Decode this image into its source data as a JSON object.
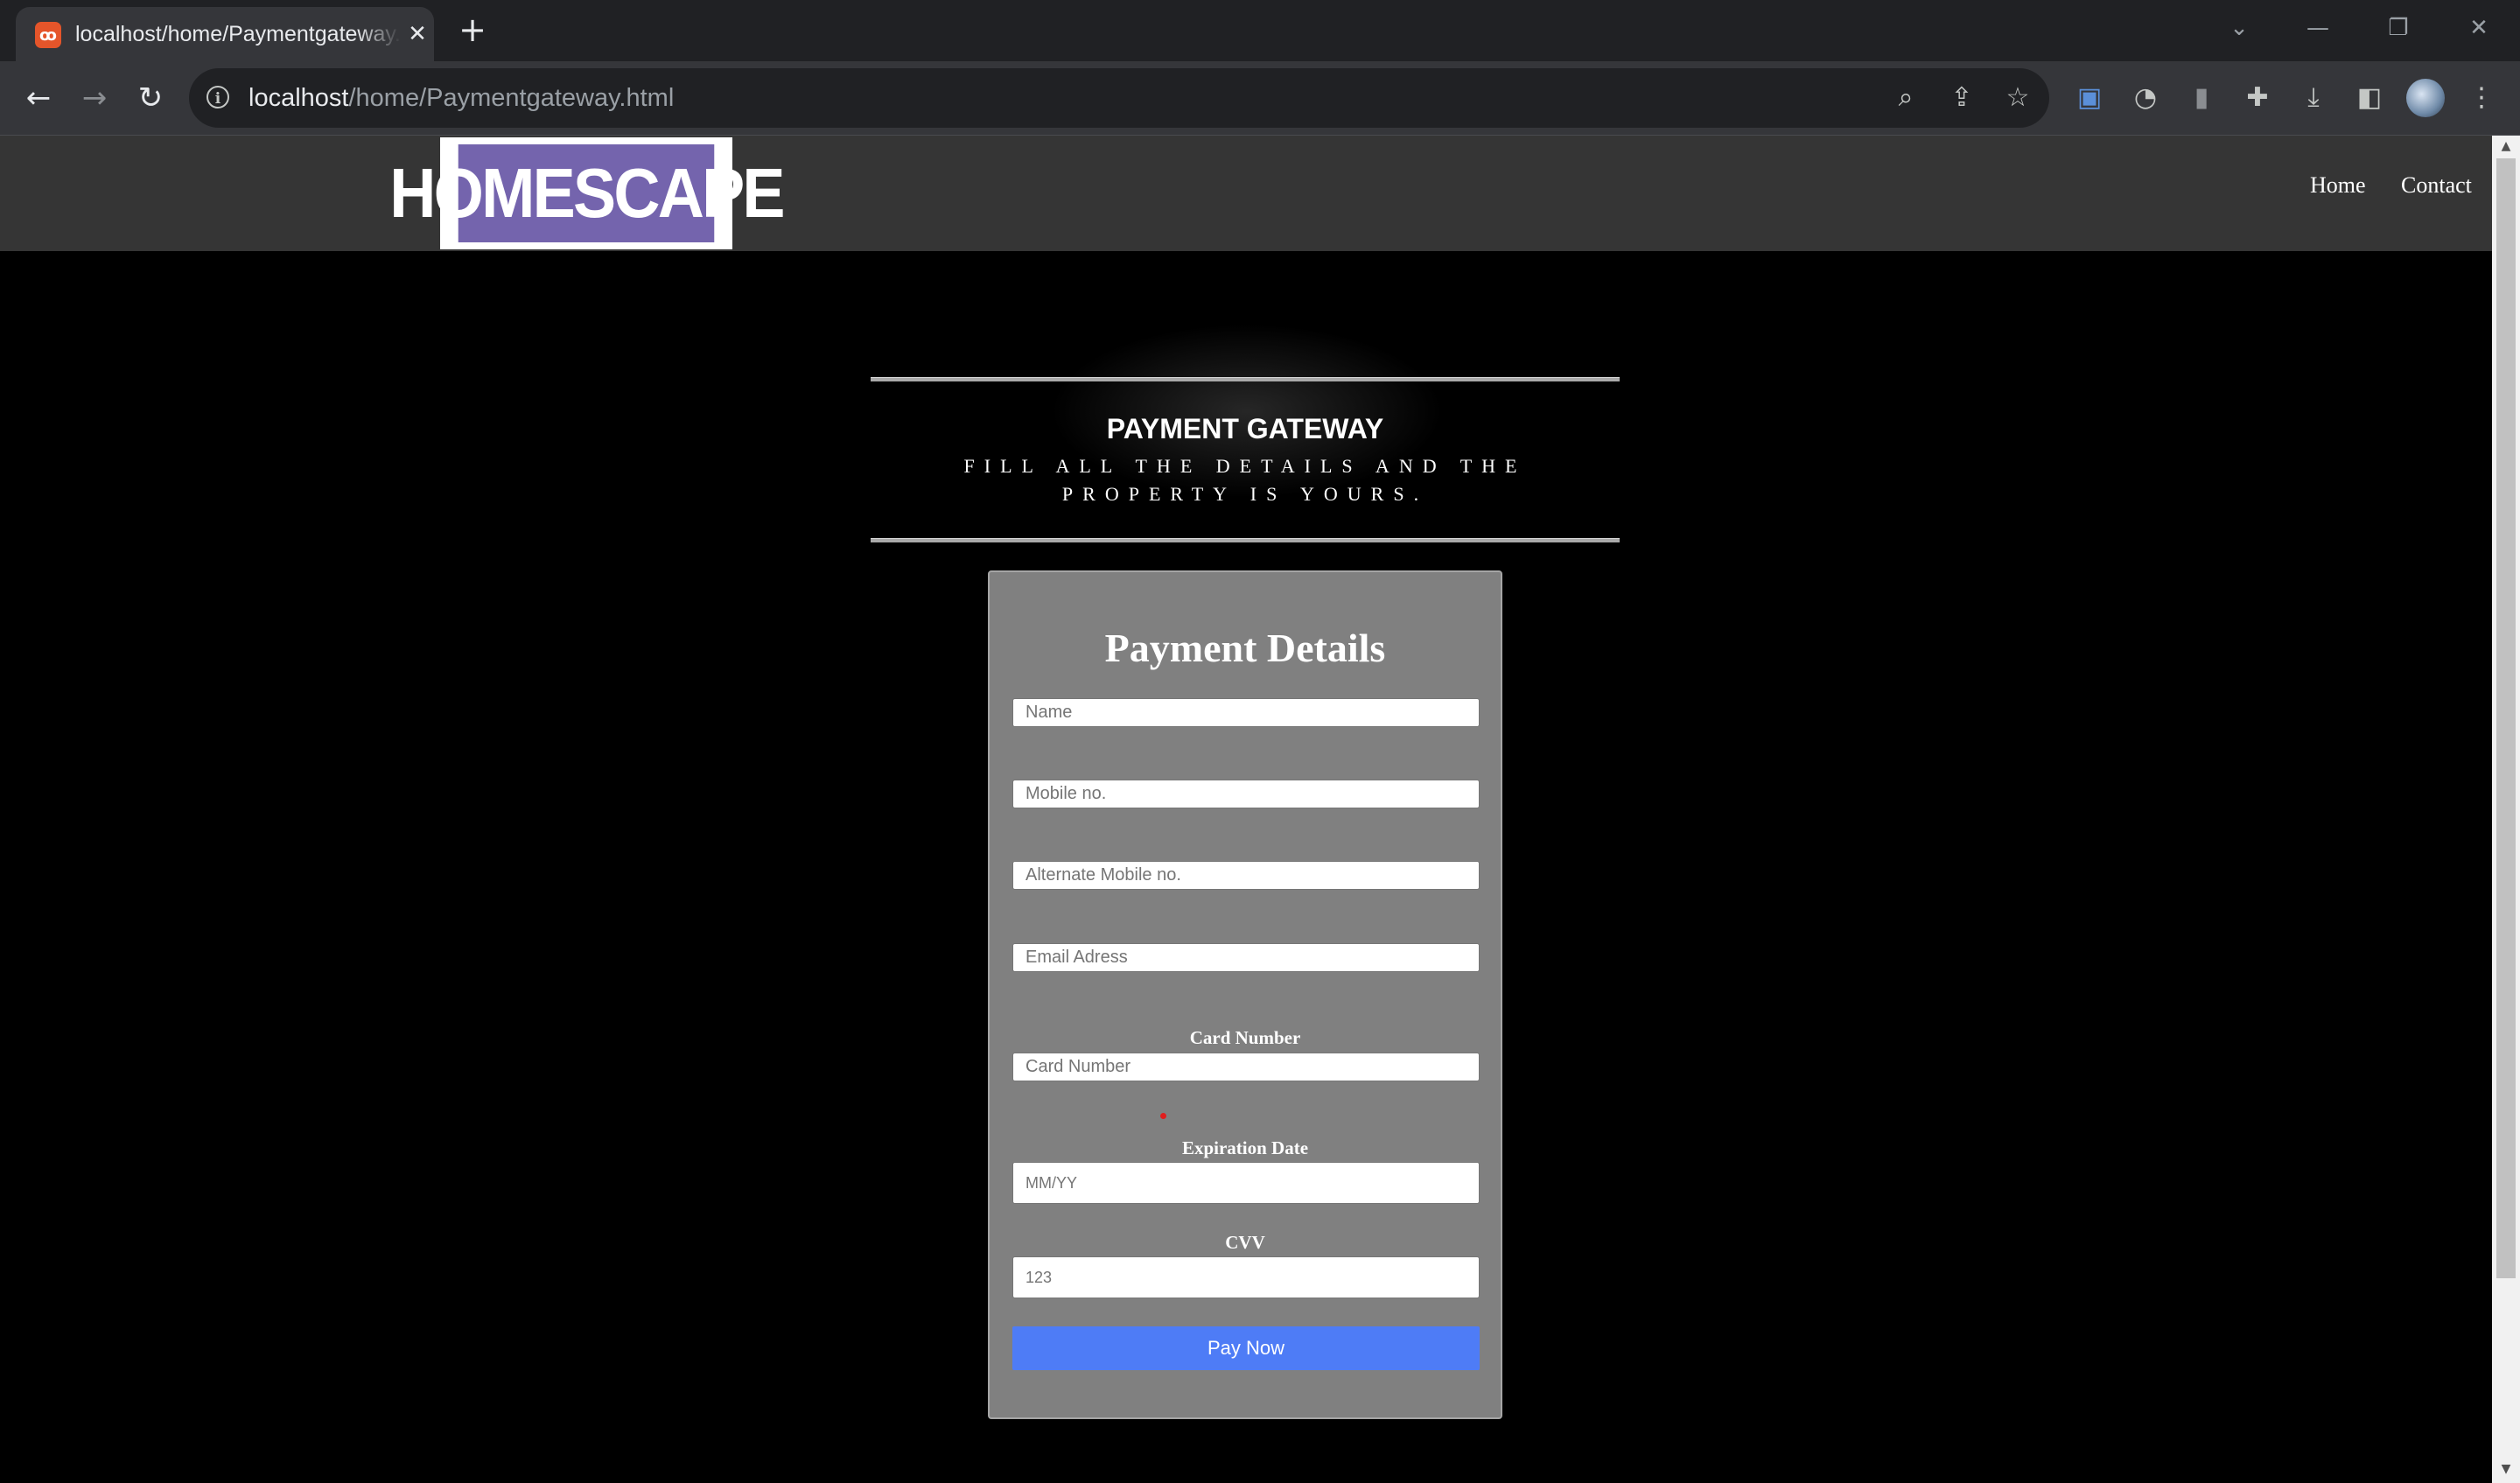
{
  "browser": {
    "tab_title": "localhost/home/Paymentgateway.html",
    "tab_close": "✕",
    "new_tab": "+",
    "url_host": "localhost",
    "url_path": "/home/Paymentgateway.html",
    "window_controls": {
      "dropdown": "⌄",
      "minimize": "—",
      "restore": "❐",
      "close": "✕"
    },
    "nav": {
      "back": "←",
      "forward": "→",
      "reload": "↻"
    }
  },
  "header": {
    "logo_text": "HOMESCAPE",
    "nav_links": [
      "Home",
      "Contact"
    ]
  },
  "hero": {
    "title": "PAYMENT GATEWAY",
    "subtitle": "FILL ALL THE DETAILS AND THE PROPERTY IS YOURS."
  },
  "form": {
    "title": "Payment Details",
    "name_placeholder": "Name",
    "mobile_placeholder": "Mobile no.",
    "alt_mobile_placeholder": "Alternate Mobile no.",
    "email_placeholder": "Email Adress",
    "card_number_label": "Card Number",
    "card_number_placeholder": "Card Number",
    "expiry_label": "Expiration Date",
    "expiry_placeholder": "MM/YY",
    "cvv_label": "CVV",
    "cvv_placeholder": "123",
    "submit_label": "Pay Now"
  },
  "colors": {
    "page_bg": "#000000",
    "header_bg": "#353535",
    "card_bg": "#808080",
    "button": "#4e7cf6",
    "logo": "#7464ad"
  }
}
